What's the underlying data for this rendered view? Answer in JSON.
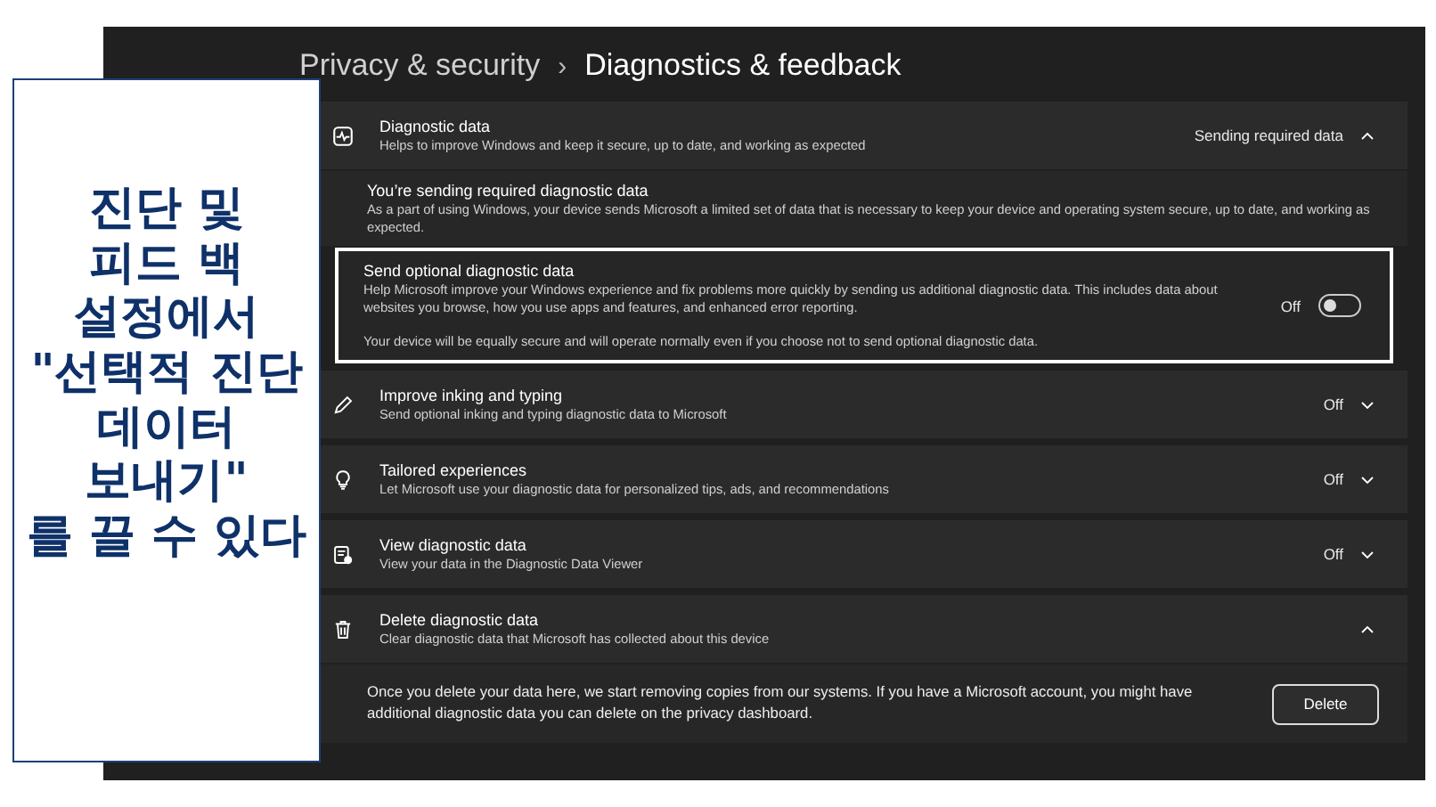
{
  "breadcrumb": {
    "parent": "Privacy & security",
    "separator": "›",
    "current": "Diagnostics & feedback"
  },
  "callout": {
    "text": "진단 및\n피드 백\n설정에서\n\"선택적 진단\n데이터\n보내기\"\n를 끌 수 있다"
  },
  "settings": [
    {
      "title": "Diagnostic data",
      "description": "Helps to improve Windows and keep it secure, up to date, and working as expected",
      "status": "Sending required data",
      "expanded": true,
      "children": [
        {
          "kind": "info",
          "title": "You’re sending required diagnostic data",
          "description": "As a part of using Windows, your device sends Microsoft a limited set of data that is necessary to keep your device and operating system secure, up to date, and working as expected."
        },
        {
          "kind": "toggle",
          "title": "Send optional diagnostic data",
          "description": "Help Microsoft improve your Windows experience and fix problems more quickly by sending us additional diagnostic data. This includes data about websites you browse, how you use apps and features, and enhanced error reporting.",
          "note": "Your device will be equally secure and will operate normally even if you choose not to send optional diagnostic data.",
          "state_label": "Off",
          "on": false,
          "highlighted": true
        }
      ]
    },
    {
      "title": "Improve inking and typing",
      "description": "Send optional inking and typing diagnostic data to Microsoft",
      "status": "Off",
      "expanded": false
    },
    {
      "title": "Tailored experiences",
      "description": "Let Microsoft use your diagnostic data for personalized tips, ads, and recommendations",
      "status": "Off",
      "expanded": false
    },
    {
      "title": "View diagnostic data",
      "description": "View your data in the Diagnostic Data Viewer",
      "status": "Off",
      "expanded": false
    },
    {
      "title": "Delete diagnostic data",
      "description": "Clear diagnostic data that Microsoft has collected about this device",
      "expanded": true,
      "children": [
        {
          "kind": "action",
          "description": "Once you delete your data here, we start removing copies from our systems. If you have a Microsoft account, you might have additional diagnostic data you can delete on the privacy dashboard.",
          "button": "Delete"
        }
      ]
    }
  ]
}
